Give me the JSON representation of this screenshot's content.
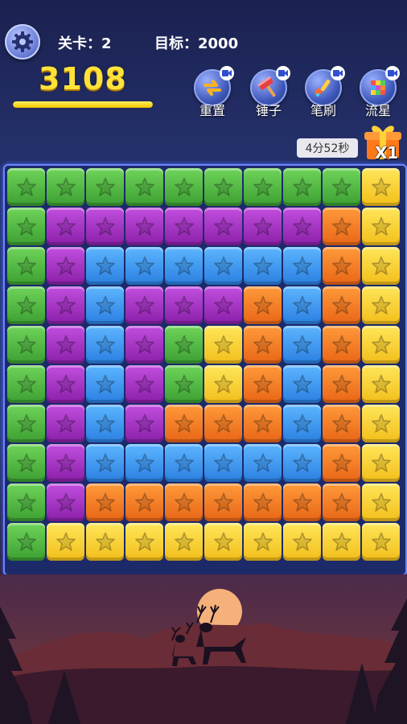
{
  "hud": {
    "level_label": "关卡：",
    "level_value": "2",
    "target_label": "目标：",
    "target_value": "2000",
    "score": "3108",
    "progress_fraction": 1.0,
    "timer": "4分52秒",
    "gift_multiplier": "X1"
  },
  "tools": [
    {
      "label": "重置",
      "icon": "reset-icon"
    },
    {
      "label": "锤子",
      "icon": "hammer-icon"
    },
    {
      "label": "笔刷",
      "icon": "brush-icon"
    },
    {
      "label": "流星",
      "icon": "meteor-icon"
    }
  ],
  "colors": {
    "G": "#4bb53e",
    "P": "#a333c6",
    "B": "#3d97f0",
    "O": "#f47a22",
    "Y": "#f7d22e"
  },
  "board": [
    "GGGGGGGGGY",
    "GPPPPPPPOY",
    "GPBBBBBBOY",
    "GPBPPPOBOY",
    "GPBPGYOBOY",
    "GPBPGYOBOY",
    "GPBPOOOBOY",
    "GPBBBBBBOY",
    "GPOOOOOOOY",
    "GYYYYYYYYY"
  ]
}
